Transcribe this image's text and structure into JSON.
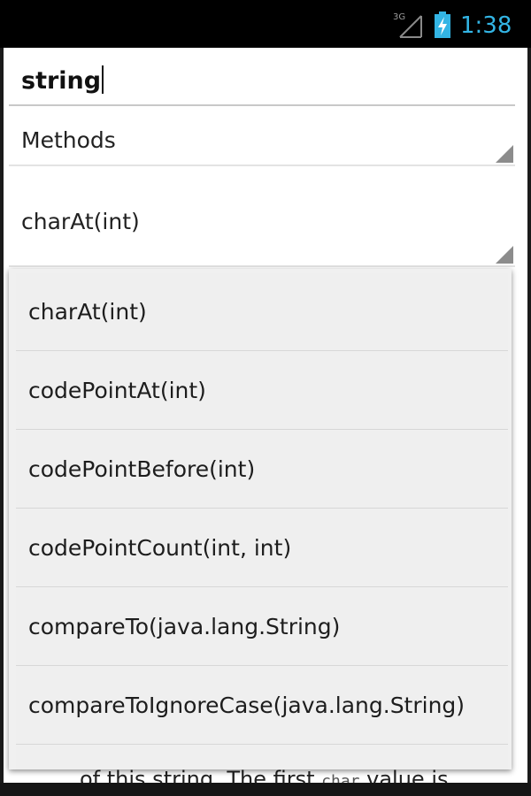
{
  "status_bar": {
    "network_label": "3G",
    "time": "1:38",
    "accent_color": "#33b5e5",
    "icons": [
      "signal-icon",
      "battery-charging-icon"
    ]
  },
  "search": {
    "value": "string"
  },
  "category_spinner": {
    "selected": "Methods"
  },
  "method_spinner": {
    "selected": "charAt(int)"
  },
  "dropdown": {
    "items": [
      "charAt(int)",
      "codePointAt(int)",
      "codePointBefore(int)",
      "codePointCount(int, int)",
      "compareTo(java.lang.String)",
      "compareToIgnoreCase(java.lang.String)",
      ""
    ]
  },
  "content_peek": {
    "text_before": "of this string. The first",
    "code": "char",
    "text_after": "value is"
  }
}
